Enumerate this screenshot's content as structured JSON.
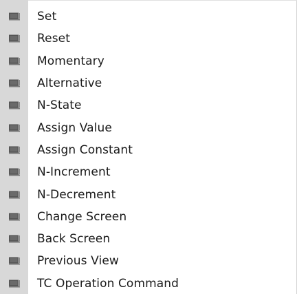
{
  "menu": {
    "items": [
      {
        "label": "Set",
        "icon": "menu-item-icon"
      },
      {
        "label": "Reset",
        "icon": "menu-item-icon"
      },
      {
        "label": "Momentary",
        "icon": "menu-item-icon"
      },
      {
        "label": "Alternative",
        "icon": "menu-item-icon"
      },
      {
        "label": "N-State",
        "icon": "menu-item-icon"
      },
      {
        "label": "Assign Value",
        "icon": "menu-item-icon"
      },
      {
        "label": "Assign Constant",
        "icon": "menu-item-icon"
      },
      {
        "label": "N-Increment",
        "icon": "menu-item-icon"
      },
      {
        "label": "N-Decrement",
        "icon": "menu-item-icon"
      },
      {
        "label": "Change Screen",
        "icon": "menu-item-icon"
      },
      {
        "label": "Back Screen",
        "icon": "menu-item-icon"
      },
      {
        "label": "Previous View",
        "icon": "menu-item-icon"
      },
      {
        "label": "TC Operation Command",
        "icon": "menu-item-icon"
      }
    ]
  },
  "colors": {
    "icon_strip": "#d8d8d8",
    "icon_body": "#555555",
    "icon_base": "#7a7a7a",
    "text": "#1a1a1a"
  }
}
